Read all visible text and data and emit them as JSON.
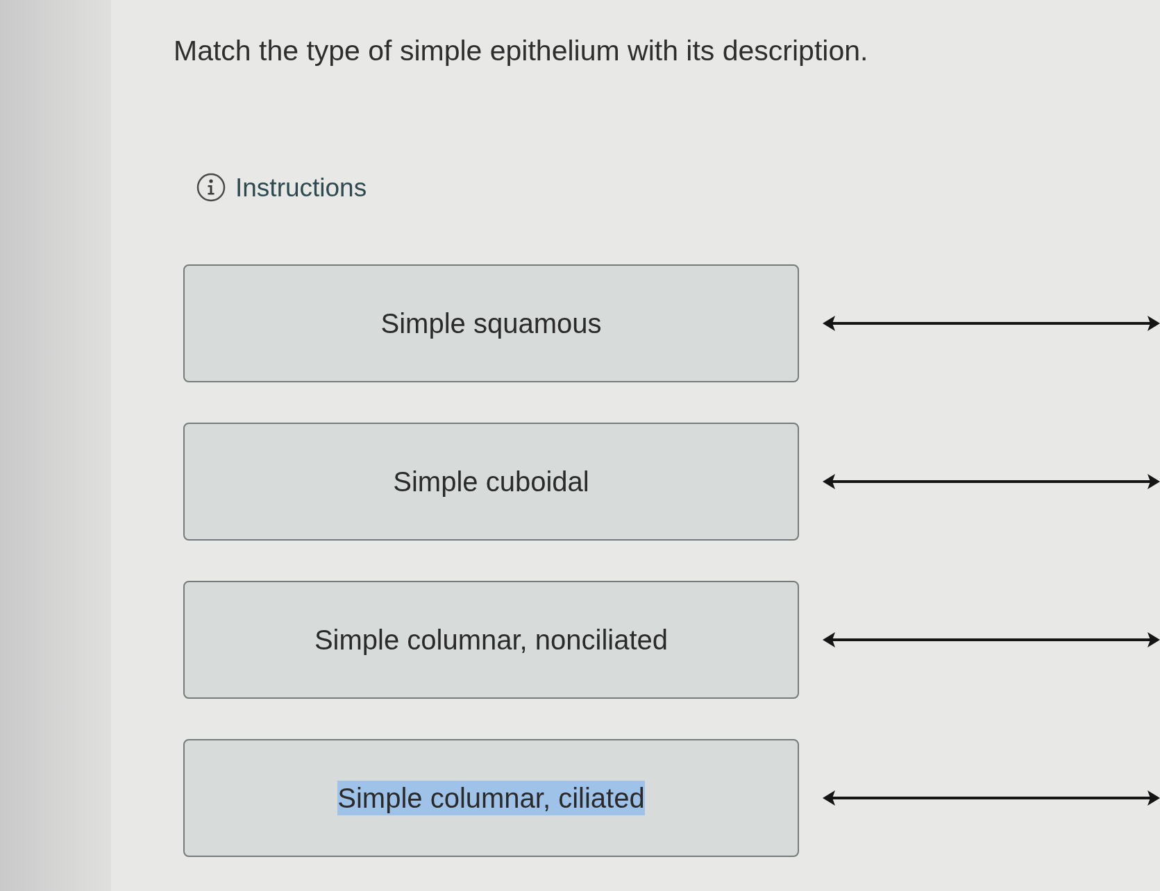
{
  "question": {
    "title": "Match the type of simple epithelium with its description."
  },
  "instructions": {
    "label": "Instructions"
  },
  "items": [
    {
      "label": "Simple squamous",
      "highlighted": false
    },
    {
      "label": "Simple cuboidal",
      "highlighted": false
    },
    {
      "label": "Simple columnar, nonciliated",
      "highlighted": false
    },
    {
      "label": "Simple columnar, ciliated",
      "highlighted": true
    }
  ]
}
